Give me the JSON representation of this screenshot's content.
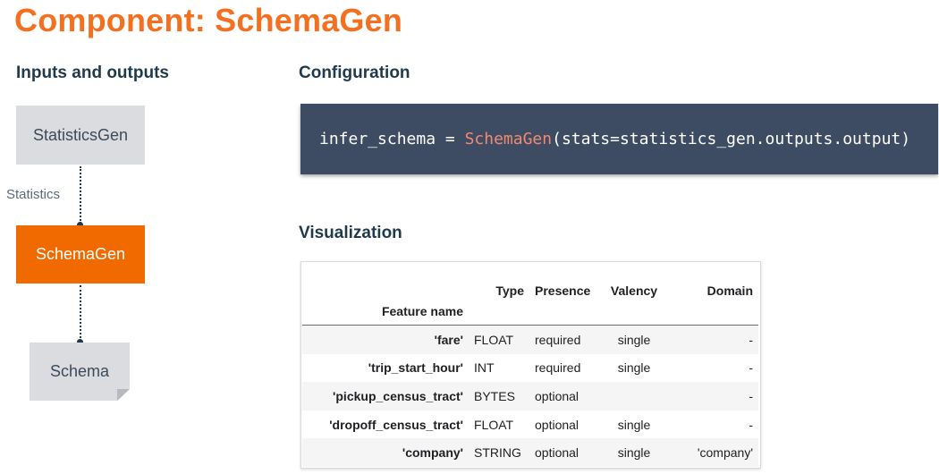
{
  "title": "Component: SchemaGen",
  "sections": {
    "inputs_outputs": "Inputs and outputs",
    "configuration": "Configuration",
    "visualization": "Visualization"
  },
  "diagram": {
    "nodes": {
      "statistics_gen": "StatisticsGen",
      "schema_gen": "SchemaGen",
      "schema": "Schema"
    },
    "edges": {
      "statistics": "Statistics"
    },
    "colors": {
      "component": "#f06a00",
      "artifact": "#dadce0"
    }
  },
  "config_code": {
    "lhs": "infer_schema",
    "eq": " = ",
    "fn": "SchemaGen",
    "args": "(stats=statistics_gen.outputs.output)"
  },
  "schema_table": {
    "headers": {
      "feature_name": "Feature name",
      "type": "Type",
      "presence": "Presence",
      "valency": "Valency",
      "domain": "Domain"
    },
    "rows": [
      {
        "name": "'fare'",
        "type": "FLOAT",
        "presence": "required",
        "valency": "single",
        "domain": "-"
      },
      {
        "name": "'trip_start_hour'",
        "type": "INT",
        "presence": "required",
        "valency": "single",
        "domain": "-"
      },
      {
        "name": "'pickup_census_tract'",
        "type": "BYTES",
        "presence": "optional",
        "valency": "",
        "domain": "-"
      },
      {
        "name": "'dropoff_census_tract'",
        "type": "FLOAT",
        "presence": "optional",
        "valency": "single",
        "domain": "-"
      },
      {
        "name": "'company'",
        "type": "STRING",
        "presence": "optional",
        "valency": "single",
        "domain": "'company'"
      }
    ]
  }
}
